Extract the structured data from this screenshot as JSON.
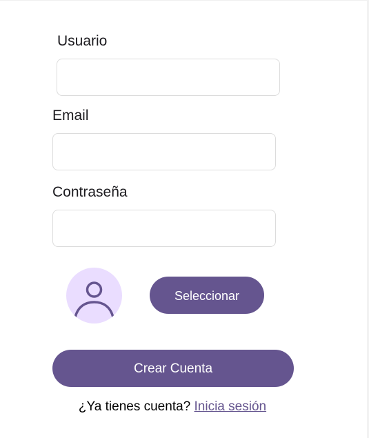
{
  "form": {
    "username": {
      "label": "Usuario",
      "value": ""
    },
    "email": {
      "label": "Email",
      "value": ""
    },
    "password": {
      "label": "Contraseña",
      "value": ""
    },
    "avatar_icon": "person-icon",
    "select_button_label": "Seleccionar",
    "submit_button_label": "Crear Cuenta"
  },
  "footer": {
    "prompt": "¿Ya tienes cuenta?",
    "login_link": "Inicia sesión"
  },
  "colors": {
    "primary": "#65558f",
    "avatar_bg": "#eaddff",
    "field_border": "#dcdcdc"
  }
}
